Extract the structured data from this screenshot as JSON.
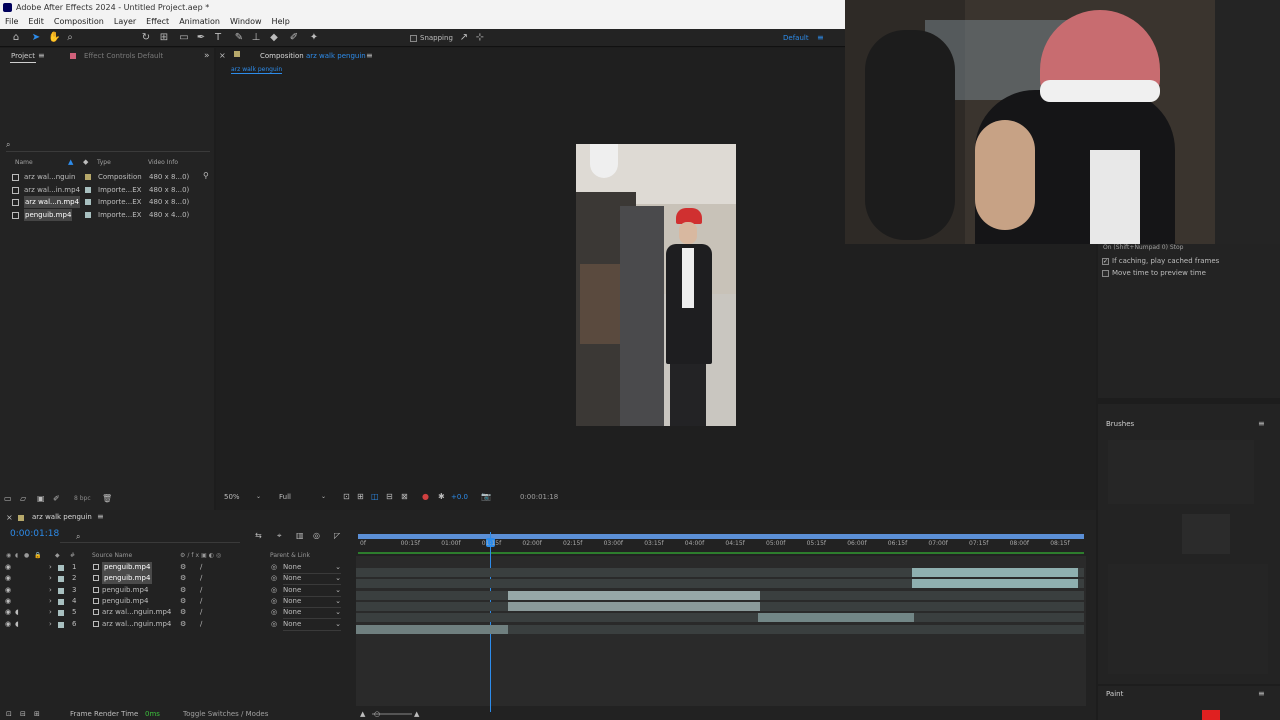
{
  "window": {
    "title": "Adobe After Effects 2024 - Untitled Project.aep *"
  },
  "menu": [
    "File",
    "Edit",
    "Composition",
    "Layer",
    "Effect",
    "Animation",
    "Window",
    "Help"
  ],
  "toolbar": {
    "snapping_label": "Snapping",
    "workspace": "Default"
  },
  "project_panel": {
    "tab_project": "Project",
    "tab_effect_controls": "Effect Controls Default",
    "columns": {
      "name": "Name",
      "type": "Type",
      "video_info": "Video Info"
    },
    "items": [
      {
        "name": "arz wal...nguin",
        "type": "Composition",
        "info": "480 x 8...0)",
        "color": "#b6a86a",
        "selected": false
      },
      {
        "name": "arz wal...in.mp4",
        "type": "Importe...EX",
        "info": "480 x 8...0)",
        "color": "#a8c0c0",
        "selected": false
      },
      {
        "name": "arz wal...n.mp4",
        "type": "Importe...EX",
        "info": "480 x 8...0)",
        "color": "#a8c0c0",
        "selected": true
      },
      {
        "name": "penguib.mp4",
        "type": "Importe...EX",
        "info": "480 x 4...0)",
        "color": "#a8c0c0",
        "selected": true
      }
    ],
    "bpc": "8 bpc"
  },
  "composition_panel": {
    "tab_label": "Composition",
    "comp_name": "arz walk penguin",
    "flow_label": "arz walk penguin",
    "zoom": "50%",
    "resolution": "Full",
    "exposure": "+0.0",
    "timecode": "0:00:01:18"
  },
  "preview_panel": {
    "shortcut": "On (Shift+Numpad 0) Stop",
    "if_caching": "If caching, play cached frames",
    "move_time": "Move time to preview time"
  },
  "brushes_panel": {
    "title": "Brushes",
    "paint_title": "Paint"
  },
  "timeline": {
    "tab_label": "arz walk penguin",
    "current_time": "0:00:01:18",
    "ruler": [
      "0f",
      "00:15f",
      "01:00f",
      "01:15f",
      "02:00f",
      "02:15f",
      "03:00f",
      "03:15f",
      "04:00f",
      "04:15f",
      "05:00f",
      "05:15f",
      "06:00f",
      "06:15f",
      "07:00f",
      "07:15f",
      "08:00f",
      "08:15f"
    ],
    "headers": {
      "source_name": "Source Name",
      "parent_link": "Parent & Link"
    },
    "layers": [
      {
        "num": "1",
        "name": "penguib.mp4",
        "parent": "None",
        "selected": true,
        "audio": false
      },
      {
        "num": "2",
        "name": "penguib.mp4",
        "parent": "None",
        "selected": true,
        "audio": false
      },
      {
        "num": "3",
        "name": "penguib.mp4",
        "parent": "None",
        "selected": false,
        "audio": false
      },
      {
        "num": "4",
        "name": "penguib.mp4",
        "parent": "None",
        "selected": false,
        "audio": false
      },
      {
        "num": "5",
        "name": "arz wal...nguin.mp4",
        "parent": "None",
        "selected": false,
        "audio": true
      },
      {
        "num": "6",
        "name": "arz wal...nguin.mp4",
        "parent": "None",
        "selected": false,
        "audio": true
      }
    ],
    "footer": {
      "frame_render_label": "Frame Render Time",
      "frame_render_value": "0ms",
      "toggle_label": "Toggle Switches / Modes"
    }
  },
  "colors": {
    "accent": "#2d8ceb",
    "label_aqua": "#a8c0c0",
    "work_area": "#2d7d2d"
  }
}
